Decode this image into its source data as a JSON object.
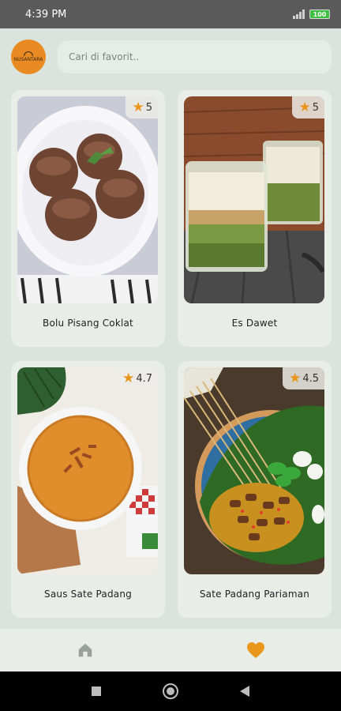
{
  "status": {
    "time": "4:39 PM",
    "battery": "100"
  },
  "header": {
    "avatar_text": "NUSANTARA",
    "search_placeholder": "Cari di favorit.."
  },
  "recipes": [
    {
      "name": "Bolu Pisang Coklat",
      "rating": "5"
    },
    {
      "name": "Es Dawet",
      "rating": "5"
    },
    {
      "name": "Saus Sate Padang",
      "rating": "4.7"
    },
    {
      "name": "Sate Padang Pariaman",
      "rating": "4.5"
    }
  ],
  "nav": {
    "active_tab": "favorites",
    "items": [
      "home-icon",
      "heart-icon"
    ]
  },
  "colors": {
    "accent": "#e8961c",
    "background": "#dbe4dc",
    "card": "#e8ede8"
  }
}
